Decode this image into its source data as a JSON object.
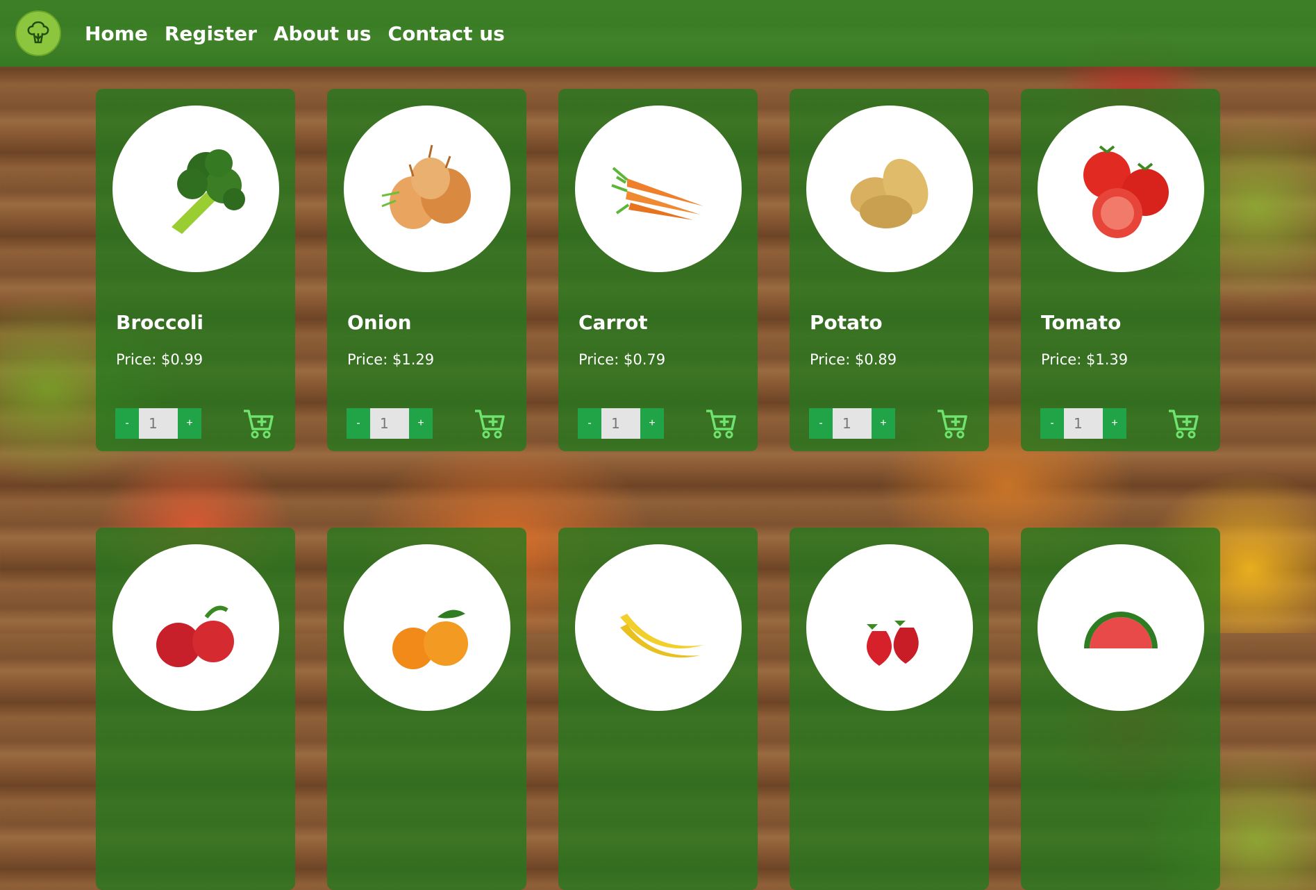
{
  "nav": {
    "logo_icon": "broccoli-logo-icon",
    "links": [
      "Home",
      "Register",
      "About us",
      "Contact us"
    ]
  },
  "products": [
    {
      "name": "Broccoli",
      "price": "Price: $0.99",
      "qty": "1",
      "icon": "broccoli-icon"
    },
    {
      "name": "Onion",
      "price": "Price: $1.29",
      "qty": "1",
      "icon": "onion-icon"
    },
    {
      "name": "Carrot",
      "price": "Price: $0.79",
      "qty": "1",
      "icon": "carrot-icon"
    },
    {
      "name": "Potato",
      "price": "Price: $0.89",
      "qty": "1",
      "icon": "potato-icon"
    },
    {
      "name": "Tomato",
      "price": "Price: $1.39",
      "qty": "1",
      "icon": "tomato-icon"
    }
  ],
  "products_row2": [
    {
      "icon": "apple-icon"
    },
    {
      "icon": "orange-icon"
    },
    {
      "icon": "banana-icon"
    },
    {
      "icon": "strawberry-icon"
    },
    {
      "icon": "watermelon-icon"
    }
  ],
  "controls": {
    "minus": "-",
    "plus": "+",
    "cart_icon": "add-to-cart-icon"
  },
  "colors": {
    "navbar": "#228b22",
    "card": "#22781e",
    "accent": "#21a447",
    "cart": "#6ee36e",
    "logo": "#8cc63f"
  }
}
